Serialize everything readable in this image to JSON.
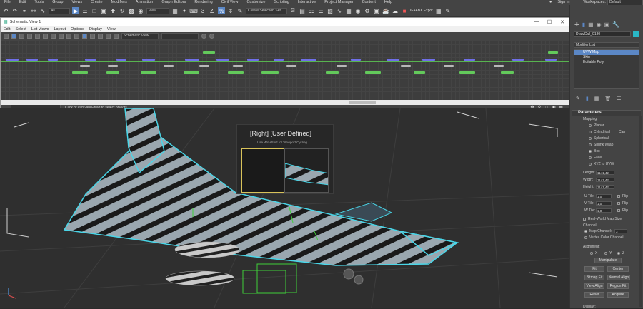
{
  "menubar": {
    "items": [
      "File",
      "Edit",
      "Tools",
      "Group",
      "Views",
      "Create",
      "Modifiers",
      "Animation",
      "Graph Editors",
      "Rendering",
      "Civil View",
      "Customize",
      "Scripting",
      "Interactive",
      "Project Manager",
      "Content",
      "Help"
    ],
    "sign_in": "Sign In",
    "workspaces_label": "Workspaces:",
    "workspaces_value": "Default"
  },
  "toolbar": {
    "selection_filter": "All",
    "view_ref": "View",
    "selection_set": "Create Selection Set",
    "plugin_label": "IE+FBX Expor"
  },
  "schematic": {
    "title": "Schematic View 1",
    "menu": [
      "Edit",
      "Select",
      "List Views",
      "Layout",
      "Options",
      "Display",
      "View"
    ],
    "view_name": "Schematic View 1",
    "status": "Click or click-and-drag to select objects",
    "controls": {
      "minimize": "—",
      "maximize": "☐",
      "close": "✕"
    }
  },
  "viewport": {
    "label": "[Right] [User Defined]",
    "hint": "Use Win+Shift for Viewport Cycling"
  },
  "command_panel": {
    "object_name": "DrawCall_0180",
    "modifier_list": "Modifier List",
    "stack": [
      {
        "label": "UVW Map",
        "selected": true
      },
      {
        "label": "Skin",
        "selected": false
      },
      {
        "label": "Editable Poly",
        "selected": false
      }
    ],
    "rollout_title": "Parameters",
    "mapping_label": "Mapping:",
    "mapping_options": [
      {
        "label": "Planar",
        "on": false
      },
      {
        "label": "Cylindrical",
        "on": false
      },
      {
        "label": "Spherical",
        "on": false
      },
      {
        "label": "Shrink Wrap",
        "on": false
      },
      {
        "label": "Box",
        "on": true
      },
      {
        "label": "Face",
        "on": false
      },
      {
        "label": "XYZ to UVW",
        "on": false
      }
    ],
    "cap_label": "Cap",
    "length_label": "Length:",
    "length_value": "1141,42",
    "width_label": "Width:",
    "width_value": "1141,42",
    "height_label": "Height:",
    "height_value": "1141,42",
    "utile_label": "U Tile:",
    "utile_value": "1,0",
    "vtile_label": "V Tile:",
    "vtile_value": "1,0",
    "wtile_label": "W Tile:",
    "wtile_value": "1,0",
    "flip_label": "Flip",
    "real_world": "Real-World Map Size",
    "channel_label": "Channel:",
    "map_channel": "Map Channel:",
    "map_channel_value": "3",
    "vertex_color": "Vertex Color Channel",
    "alignment_label": "Alignment:",
    "align_axes": [
      {
        "label": "X",
        "on": false
      },
      {
        "label": "Y",
        "on": false
      },
      {
        "label": "Z",
        "on": true
      }
    ],
    "buttons": [
      "Manipulate",
      "Fit",
      "Center",
      "Bitmap Fit",
      "Normal Align",
      "View Align",
      "Region Fit",
      "Reset",
      "Acquire"
    ],
    "display_label": "Display:"
  }
}
